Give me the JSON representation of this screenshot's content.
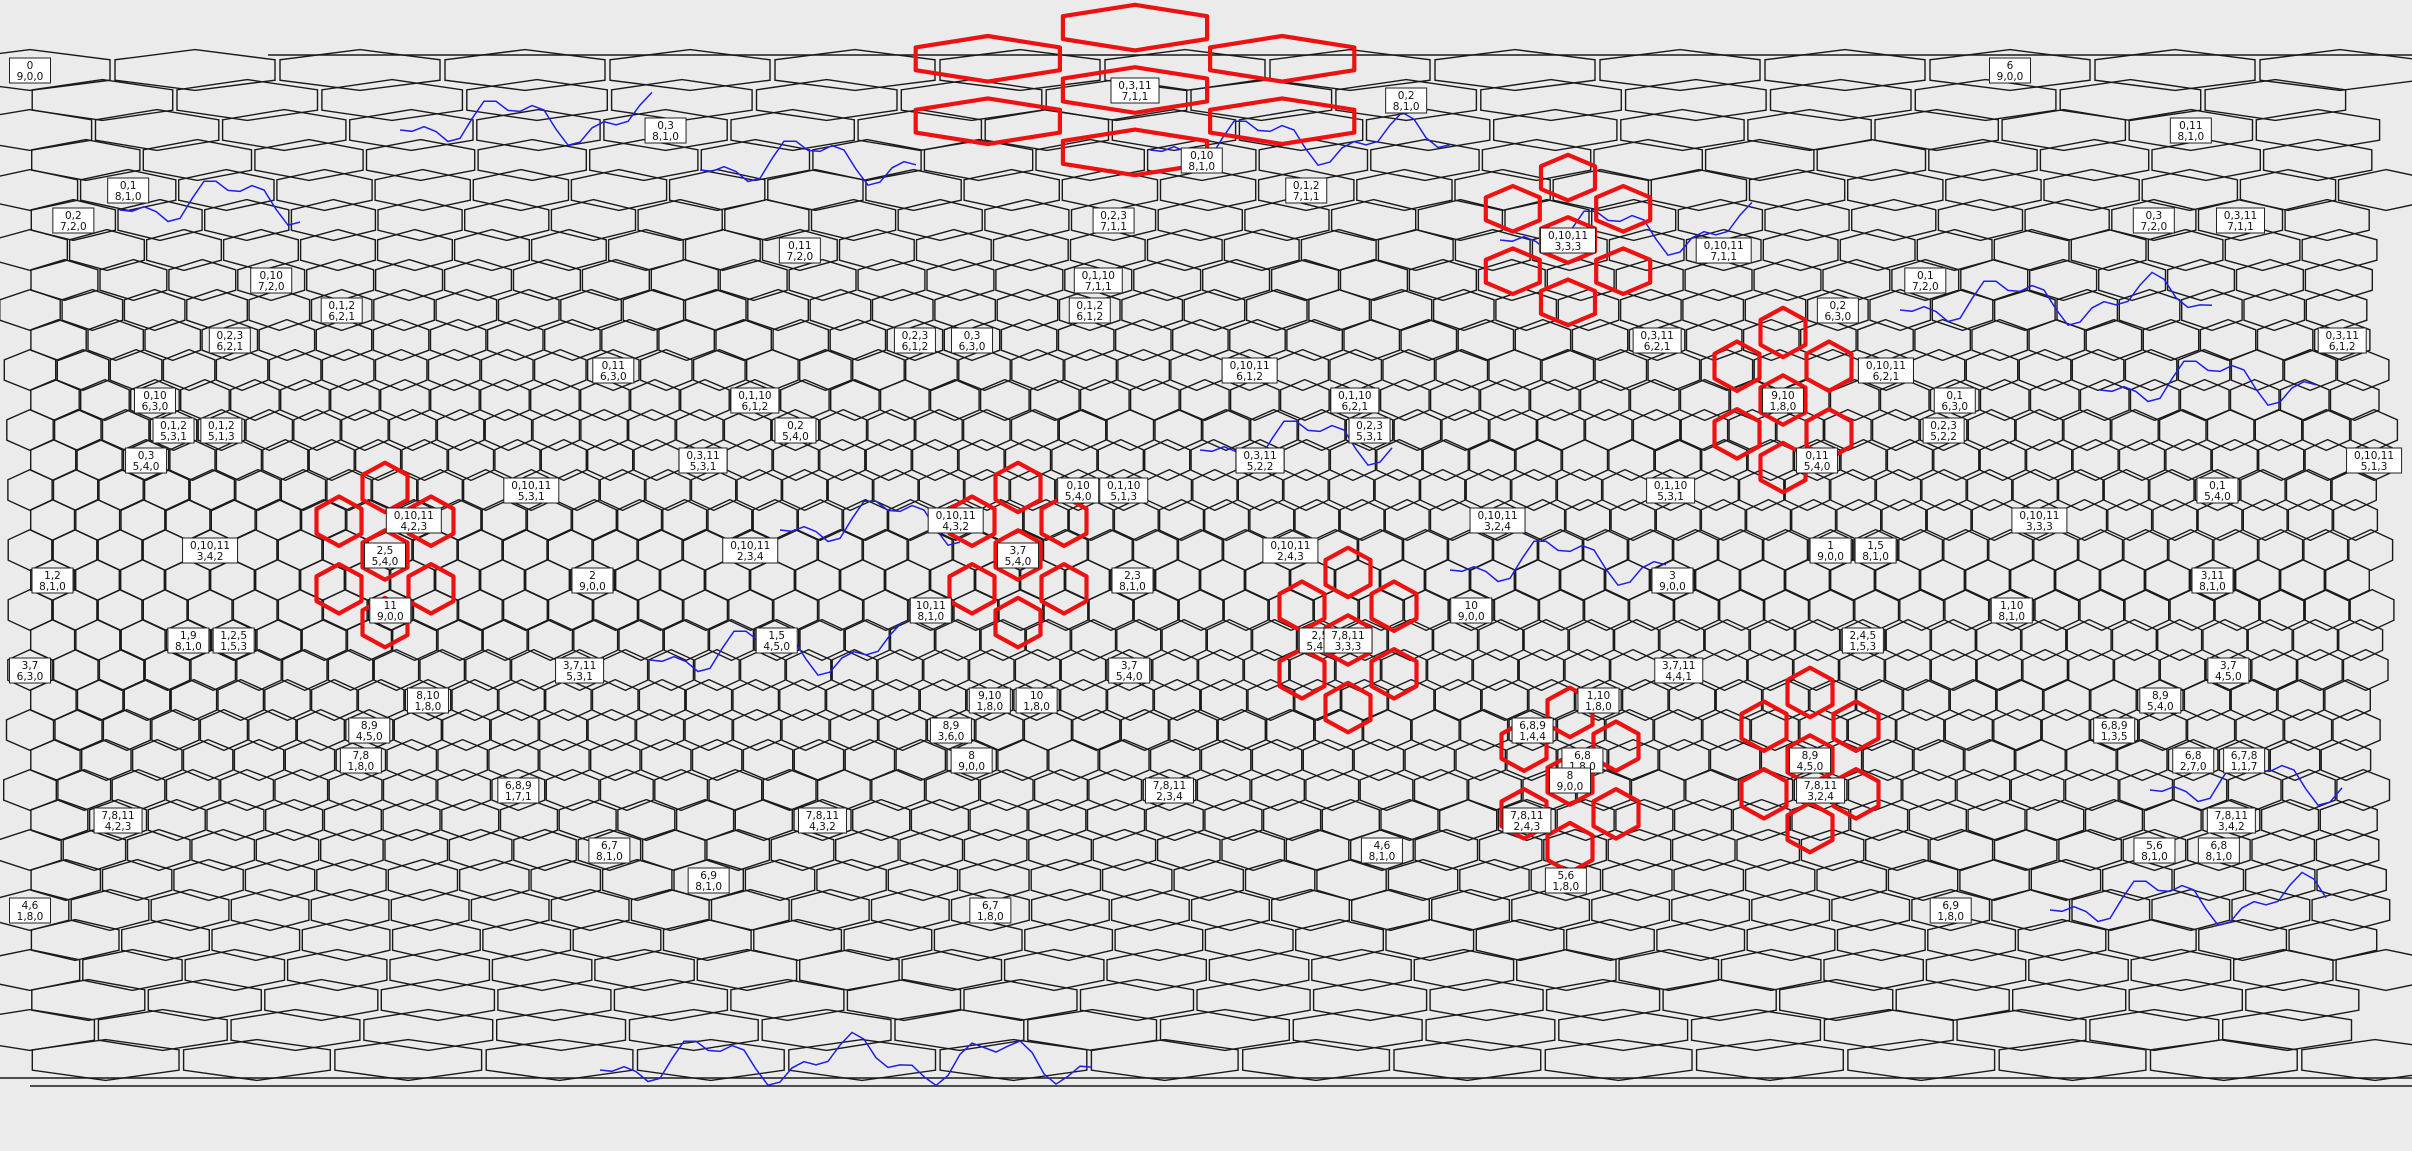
{
  "map": {
    "type": "hexagonal-grid-map",
    "grid_lines_color": "#1a1a1a",
    "highlight_color": "#ee1111",
    "coastline_color": "#1f1fe6",
    "background": "#ebebeb",
    "cells": [
      {
        "id": "0",
        "sub": "9,0,0"
      },
      {
        "id": "6",
        "sub": "9,0,0"
      },
      {
        "id": "0,2",
        "sub": "8,1,0"
      },
      {
        "id": "0,3",
        "sub": "8,1,0"
      },
      {
        "id": "0,11",
        "sub": "8,1,0"
      },
      {
        "id": "0,10",
        "sub": "8,1,0"
      },
      {
        "id": "0,1",
        "sub": "8,1,0"
      },
      {
        "id": "0,1,2",
        "sub": "7,1,1"
      },
      {
        "id": "0,2",
        "sub": "7,2,0"
      },
      {
        "id": "0,2,3",
        "sub": "7,1,1"
      },
      {
        "id": "0,3",
        "sub": "7,2,0"
      },
      {
        "id": "0,3,11",
        "sub": "7,1,1"
      },
      {
        "id": "0,11",
        "sub": "7,2,0"
      },
      {
        "id": "0,10,11",
        "sub": "7,1,1"
      },
      {
        "id": "0,10",
        "sub": "7,2,0"
      },
      {
        "id": "0,1,10",
        "sub": "7,1,1"
      },
      {
        "id": "0,1",
        "sub": "7,2,0"
      },
      {
        "id": "0,1,2",
        "sub": "6,2,1"
      },
      {
        "id": "0,1,2",
        "sub": "6,1,2"
      },
      {
        "id": "0,2",
        "sub": "6,3,0"
      },
      {
        "id": "0,2,3",
        "sub": "6,2,1"
      },
      {
        "id": "0,2,3",
        "sub": "6,1,2"
      },
      {
        "id": "0,3",
        "sub": "6,3,0"
      },
      {
        "id": "0,3,11",
        "sub": "6,2,1"
      },
      {
        "id": "0,3,11",
        "sub": "6,1,2"
      },
      {
        "id": "0,11",
        "sub": "6,3,0"
      },
      {
        "id": "0,10,11",
        "sub": "6,1,2"
      },
      {
        "id": "0,10,11",
        "sub": "6,2,1"
      },
      {
        "id": "0,10",
        "sub": "6,3,0"
      },
      {
        "id": "0,1,10",
        "sub": "6,1,2"
      },
      {
        "id": "0,1,10",
        "sub": "6,2,1"
      },
      {
        "id": "0,1",
        "sub": "6,3,0"
      },
      {
        "id": "0,1,2",
        "sub": "5,3,1"
      },
      {
        "id": "0,1,2",
        "sub": "5,1,3"
      },
      {
        "id": "0,2",
        "sub": "5,4,0"
      },
      {
        "id": "0,2,3",
        "sub": "5,3,1"
      },
      {
        "id": "0,2,3",
        "sub": "5,2,2"
      },
      {
        "id": "0,3",
        "sub": "5,4,0"
      },
      {
        "id": "0,3,11",
        "sub": "5,3,1"
      },
      {
        "id": "0,3,11",
        "sub": "5,2,2"
      },
      {
        "id": "0,11",
        "sub": "5,4,0"
      },
      {
        "id": "0,10,11",
        "sub": "5,1,3"
      },
      {
        "id": "0,10,11",
        "sub": "5,3,1"
      },
      {
        "id": "0,10",
        "sub": "5,4,0"
      },
      {
        "id": "0,1,10",
        "sub": "5,1,3"
      },
      {
        "id": "0,1,10",
        "sub": "5,3,1"
      },
      {
        "id": "0,1",
        "sub": "5,4,0"
      },
      {
        "id": "0,10,11",
        "sub": "4,2,3"
      },
      {
        "id": "0,10,11",
        "sub": "4,3,2"
      },
      {
        "id": "0,10,11",
        "sub": "3,2,4"
      },
      {
        "id": "0,10,11",
        "sub": "3,3,3"
      },
      {
        "id": "0,10,11",
        "sub": "3,4,2"
      },
      {
        "id": "0,10,11",
        "sub": "2,3,4"
      },
      {
        "id": "0,10,11",
        "sub": "2,4,3"
      },
      {
        "id": "1",
        "sub": "9,0,0"
      },
      {
        "id": "1,5",
        "sub": "8,1,0"
      },
      {
        "id": "1,2",
        "sub": "8,1,0"
      },
      {
        "id": "2",
        "sub": "9,0,0"
      },
      {
        "id": "2,3",
        "sub": "8,1,0"
      },
      {
        "id": "3",
        "sub": "9,0,0"
      },
      {
        "id": "3,11",
        "sub": "8,1,0"
      },
      {
        "id": "11",
        "sub": "9,0,0"
      },
      {
        "id": "10,11",
        "sub": "8,1,0"
      },
      {
        "id": "10",
        "sub": "9,0,0"
      },
      {
        "id": "1,10",
        "sub": "8,1,0"
      },
      {
        "id": "1,9",
        "sub": "8,1,0"
      },
      {
        "id": "1,2,5",
        "sub": "1,5,3"
      },
      {
        "id": "1,5",
        "sub": "4,5,0"
      },
      {
        "id": "2,5",
        "sub": "5,4,0"
      },
      {
        "id": "2,4,5",
        "sub": "1,5,3"
      },
      {
        "id": "3,7",
        "sub": "6,3,0"
      },
      {
        "id": "3,7,11",
        "sub": "5,3,1"
      },
      {
        "id": "3,7",
        "sub": "5,4,0"
      },
      {
        "id": "3,7,11",
        "sub": "4,4,1"
      },
      {
        "id": "3,7",
        "sub": "4,5,0"
      },
      {
        "id": "8,10",
        "sub": "1,8,0"
      },
      {
        "id": "9,10",
        "sub": "1,8,0"
      },
      {
        "id": "10",
        "sub": "1,8,0"
      },
      {
        "id": "1,10",
        "sub": "1,8,0"
      },
      {
        "id": "8,9",
        "sub": "5,4,0"
      },
      {
        "id": "8,9",
        "sub": "4,5,0"
      },
      {
        "id": "8,9",
        "sub": "3,6,0"
      },
      {
        "id": "6,8,9",
        "sub": "1,4,4"
      },
      {
        "id": "6,8,9",
        "sub": "1,3,5"
      },
      {
        "id": "7,8",
        "sub": "1,8,0"
      },
      {
        "id": "8",
        "sub": "9,0,0"
      },
      {
        "id": "6,8",
        "sub": "1,8,0"
      },
      {
        "id": "6,8",
        "sub": "2,7,0"
      },
      {
        "id": "6,7,8",
        "sub": "1,1,7"
      },
      {
        "id": "6,8,9",
        "sub": "1,7,1"
      },
      {
        "id": "7,8,11",
        "sub": "2,3,4"
      },
      {
        "id": "7,8,11",
        "sub": "3,2,4"
      },
      {
        "id": "7,8,11",
        "sub": "4,2,3"
      },
      {
        "id": "7,8,11",
        "sub": "4,3,2"
      },
      {
        "id": "7,8,11",
        "sub": "2,4,3"
      },
      {
        "id": "7,8,11",
        "sub": "3,4,2"
      },
      {
        "id": "6,7",
        "sub": "8,1,0"
      },
      {
        "id": "4,6",
        "sub": "8,1,0"
      },
      {
        "id": "5,6",
        "sub": "8,1,0"
      },
      {
        "id": "6,8",
        "sub": "8,1,0"
      },
      {
        "id": "6,9",
        "sub": "8,1,0"
      },
      {
        "id": "5,6",
        "sub": "1,8,0"
      },
      {
        "id": "4,6",
        "sub": "1,8,0"
      },
      {
        "id": "6,7",
        "sub": "1,8,0"
      },
      {
        "id": "6,9",
        "sub": "1,8,0"
      }
    ],
    "highlighted_regions": [
      {
        "center": "0,3,11 / 7,1,1"
      },
      {
        "center": "0,10,11 / 3,3,3"
      },
      {
        "center": "9,10 / 1,8,0"
      },
      {
        "center": "2,5 / 5,4,0"
      },
      {
        "center": "3,7 / 5,4,0"
      },
      {
        "center": "7,8,11 / 3,3,3"
      },
      {
        "center": "8 / 9,0,0"
      },
      {
        "center": "8,9 / 4,5,0"
      }
    ]
  }
}
